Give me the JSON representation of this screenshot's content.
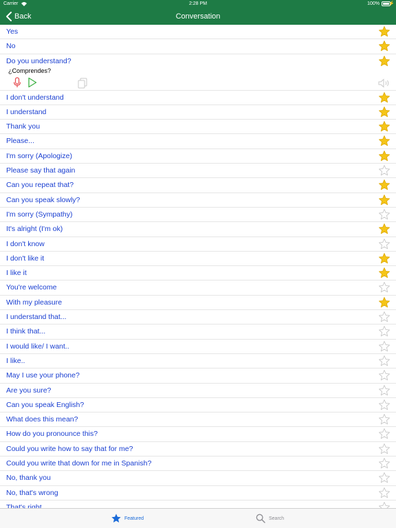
{
  "status_bar": {
    "carrier": "Carrier",
    "time": "2:28 PM",
    "battery": "100%"
  },
  "nav": {
    "back_label": "Back",
    "title": "Conversation"
  },
  "colors": {
    "nav_background": "#1e7b45",
    "phrase_text": "#1a3fd1",
    "star_filled": "#f5c518",
    "star_outline": "#c8c8c8",
    "mic": "#e5484d",
    "play": "#3cb043",
    "tab_active": "#1a6ad8",
    "tab_inactive": "#8e8e93"
  },
  "phrases": [
    {
      "text": "Yes",
      "favorite": true
    },
    {
      "text": "No",
      "favorite": true
    },
    {
      "text": "Do you understand?",
      "favorite": true,
      "expanded": true,
      "translation": "¿Comprendes?"
    },
    {
      "text": "I don't understand",
      "favorite": true
    },
    {
      "text": "I understand",
      "favorite": true
    },
    {
      "text": "Thank you",
      "favorite": true
    },
    {
      "text": "Please...",
      "favorite": true
    },
    {
      "text": "I'm sorry (Apologize)",
      "favorite": true
    },
    {
      "text": "Please say that again",
      "favorite": false
    },
    {
      "text": "Can you repeat that?",
      "favorite": true
    },
    {
      "text": "Can you speak slowly?",
      "favorite": true
    },
    {
      "text": "I'm sorry (Sympathy)",
      "favorite": false
    },
    {
      "text": "It's alright (I'm ok)",
      "favorite": true
    },
    {
      "text": "I don't know",
      "favorite": false
    },
    {
      "text": "I don't like it",
      "favorite": true
    },
    {
      "text": "I like it",
      "favorite": true
    },
    {
      "text": "You're welcome",
      "favorite": false
    },
    {
      "text": "With my pleasure",
      "favorite": true
    },
    {
      "text": "I understand that...",
      "favorite": false
    },
    {
      "text": "I think that...",
      "favorite": false
    },
    {
      "text": "I would like/ I want..",
      "favorite": false
    },
    {
      "text": "I like..",
      "favorite": false
    },
    {
      "text": "May I use your phone?",
      "favorite": false
    },
    {
      "text": "Are you sure?",
      "favorite": false
    },
    {
      "text": "Can you speak English?",
      "favorite": false
    },
    {
      "text": "What does this mean?",
      "favorite": false
    },
    {
      "text": "How do you pronounce this?",
      "favorite": false
    },
    {
      "text": "Could you write how to say that for me?",
      "favorite": false
    },
    {
      "text": "Could you write that down for me in Spanish?",
      "favorite": false
    },
    {
      "text": "No, thank you",
      "favorite": false
    },
    {
      "text": "No, that's wrong",
      "favorite": false
    },
    {
      "text": "That's right",
      "favorite": false
    }
  ],
  "tabbar": {
    "featured_label": "Featured",
    "search_label": "Search",
    "active": "Featured"
  }
}
